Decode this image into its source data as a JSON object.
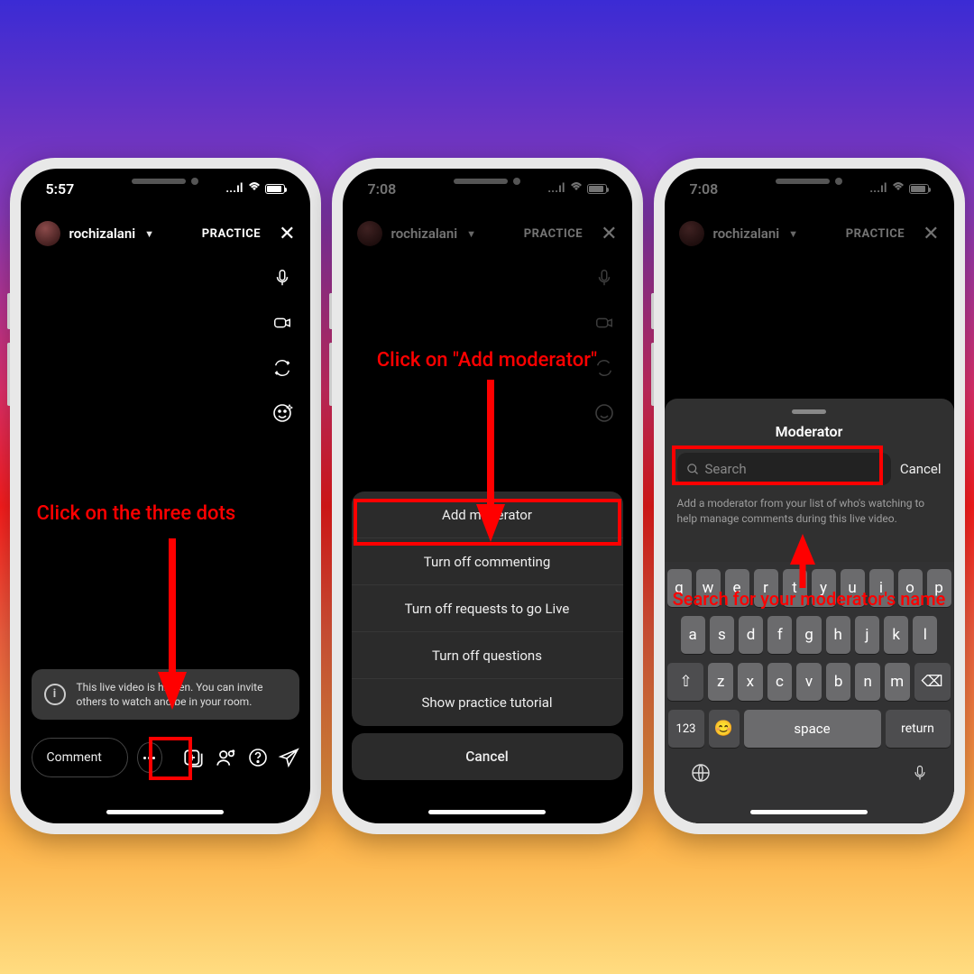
{
  "phone1": {
    "time": "5:57",
    "username": "rochizalani",
    "practice": "PRACTICE",
    "info_text": "This live video is hidden. You can invite others to watch and be in your room.",
    "comment_placeholder": "Comment",
    "annotation": "Click on the three dots"
  },
  "phone2": {
    "time": "7:08",
    "username": "rochizalani",
    "practice": "PRACTICE",
    "annotation": "Click on \"Add moderator\"",
    "sheet": {
      "items": [
        "Add moderator",
        "Turn off commenting",
        "Turn off requests to go Live",
        "Turn off questions",
        "Show practice tutorial"
      ],
      "cancel": "Cancel"
    }
  },
  "phone3": {
    "time": "7:08",
    "username": "rochizalani",
    "practice": "PRACTICE",
    "modal": {
      "title": "Moderator",
      "search_placeholder": "Search",
      "cancel": "Cancel",
      "description": "Add a moderator from your list of who's watching to help manage comments during this live video."
    },
    "annotation": "Search for your moderator's name",
    "keyboard": {
      "row1": [
        "q",
        "w",
        "e",
        "r",
        "t",
        "y",
        "u",
        "i",
        "o",
        "p"
      ],
      "row2": [
        "a",
        "s",
        "d",
        "f",
        "g",
        "h",
        "j",
        "k",
        "l"
      ],
      "row3": [
        "z",
        "x",
        "c",
        "v",
        "b",
        "n",
        "m"
      ],
      "shift": "⇧",
      "backspace": "⌫",
      "numkey": "123",
      "emoji": "😊",
      "space": "space",
      "return": "return",
      "globe": "🌐",
      "mic": "🎤"
    }
  }
}
